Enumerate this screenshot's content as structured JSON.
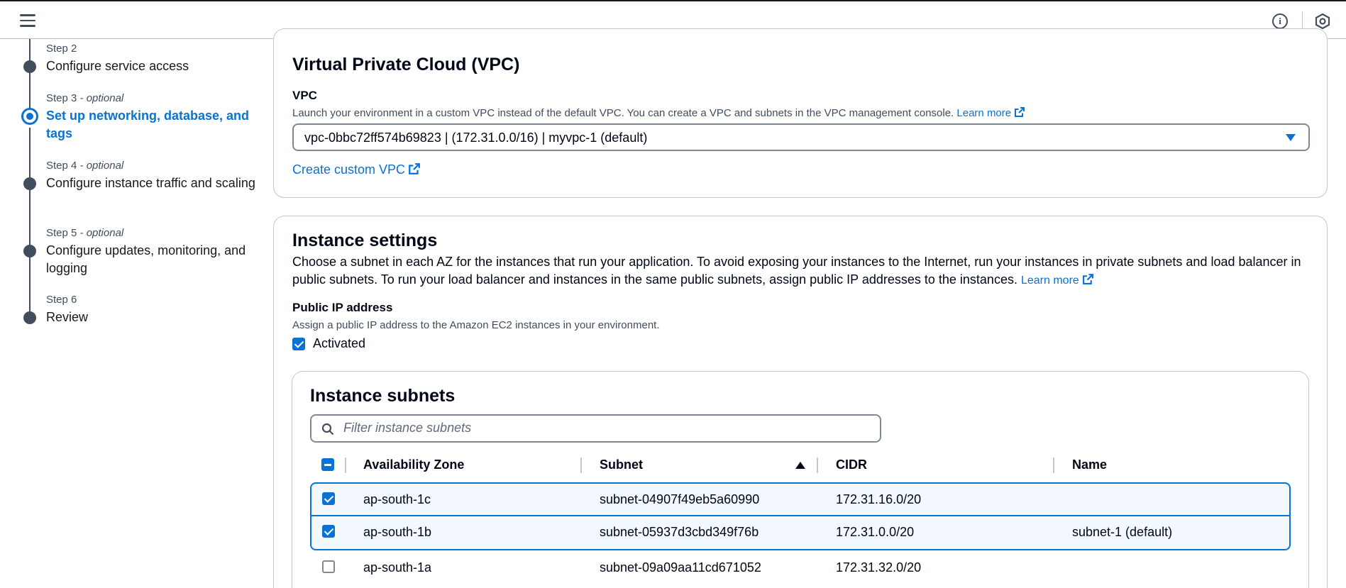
{
  "wizard": {
    "steps": [
      {
        "label": "Step 2",
        "optional": "",
        "title": "Configure service access"
      },
      {
        "label": "Step 3",
        "optional": " - optional",
        "title": "Set up networking, database, and tags"
      },
      {
        "label": "Step 4",
        "optional": " - optional",
        "title": "Configure instance traffic and scaling"
      },
      {
        "label": "Step 5",
        "optional": " - optional",
        "title": "Configure updates, monitoring, and logging"
      },
      {
        "label": "Step 6",
        "optional": "",
        "title": "Review"
      }
    ],
    "active_step": "Step 3"
  },
  "vpc_section": {
    "title": "Virtual Private Cloud (VPC)",
    "field_label": "VPC",
    "description": "Launch your environment in a custom VPC instead of the default VPC. You can create a VPC and subnets in the VPC management console.",
    "learn_more": "Learn more",
    "selected_vpc": "vpc-0bbc72ff574b69823 | (172.31.0.0/16) | myvpc-1 (default)",
    "create_link": "Create custom VPC"
  },
  "instance_settings": {
    "title": "Instance settings",
    "description": "Choose a subnet in each AZ for the instances that run your application. To avoid exposing your instances to the Internet, run your instances in private subnets and load balancer in public subnets. To run your load balancer and instances in the same public subnets, assign public IP addresses to the instances.",
    "learn_more": "Learn more",
    "public_ip_label": "Public IP address",
    "public_ip_description": "Assign a public IP address to the Amazon EC2 instances in your environment.",
    "activated_label": "Activated",
    "activated_checked": true
  },
  "subnets": {
    "title": "Instance subnets",
    "filter_placeholder": "Filter instance subnets",
    "columns": [
      "Availability Zone",
      "Subnet",
      "CIDR",
      "Name"
    ],
    "sorted_column": "Subnet",
    "rows": [
      {
        "az": "ap-south-1c",
        "subnet": "subnet-04907f49eb5a60990",
        "cidr": "172.31.16.0/20",
        "name": "",
        "checked": true
      },
      {
        "az": "ap-south-1b",
        "subnet": "subnet-05937d3cbd349f76b",
        "cidr": "172.31.0.0/20",
        "name": "subnet-1 (default)",
        "checked": true
      },
      {
        "az": "ap-south-1a",
        "subnet": "subnet-09a09aa11cd671052",
        "cidr": "172.31.32.0/20",
        "name": "",
        "checked": false
      }
    ]
  },
  "colors": {
    "accent": "#0972d3",
    "text": "#000716",
    "muted": "#414d5c",
    "selected_row_bg": "#f2f8fd"
  },
  "icons": [
    "menu-icon",
    "info-icon",
    "settings-icon",
    "external-link-icon",
    "search-icon",
    "sort-ascending-icon",
    "dropdown-caret-icon"
  ]
}
